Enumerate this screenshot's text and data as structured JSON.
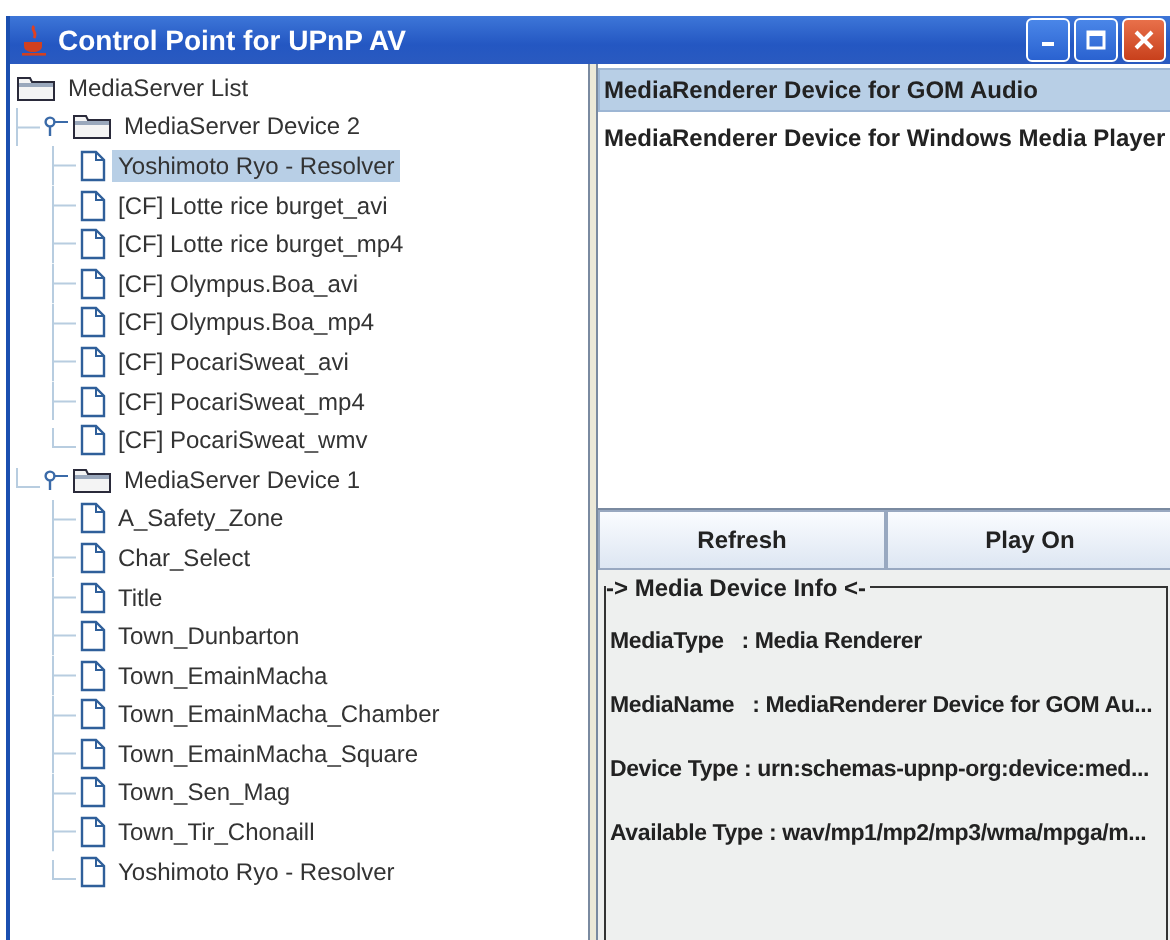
{
  "window": {
    "title": "Control Point for UPnP AV"
  },
  "tree": {
    "label": "MediaServer List",
    "kind": "folder",
    "selected": false,
    "children": [
      {
        "label": "MediaServer Device 2",
        "kind": "folder",
        "expanded": true,
        "selected": false,
        "children": [
          {
            "label": "Yoshimoto Ryo - Resolver",
            "kind": "file",
            "selected": true
          },
          {
            "label": "[CF] Lotte rice burget_avi",
            "kind": "file",
            "selected": false
          },
          {
            "label": "[CF] Lotte rice burget_mp4",
            "kind": "file",
            "selected": false
          },
          {
            "label": "[CF] Olympus.Boa_avi",
            "kind": "file",
            "selected": false
          },
          {
            "label": "[CF] Olympus.Boa_mp4",
            "kind": "file",
            "selected": false
          },
          {
            "label": "[CF] PocariSweat_avi",
            "kind": "file",
            "selected": false
          },
          {
            "label": "[CF] PocariSweat_mp4",
            "kind": "file",
            "selected": false
          },
          {
            "label": "[CF] PocariSweat_wmv",
            "kind": "file",
            "selected": false
          }
        ]
      },
      {
        "label": "MediaServer Device 1",
        "kind": "folder",
        "expanded": true,
        "selected": false,
        "children": [
          {
            "label": "A_Safety_Zone",
            "kind": "file",
            "selected": false
          },
          {
            "label": "Char_Select",
            "kind": "file",
            "selected": false
          },
          {
            "label": "Title",
            "kind": "file",
            "selected": false
          },
          {
            "label": "Town_Dunbarton",
            "kind": "file",
            "selected": false
          },
          {
            "label": "Town_EmainMacha",
            "kind": "file",
            "selected": false
          },
          {
            "label": "Town_EmainMacha_Chamber",
            "kind": "file",
            "selected": false
          },
          {
            "label": "Town_EmainMacha_Square",
            "kind": "file",
            "selected": false
          },
          {
            "label": "Town_Sen_Mag",
            "kind": "file",
            "selected": false
          },
          {
            "label": "Town_Tir_Chonaill",
            "kind": "file",
            "selected": false
          },
          {
            "label": "Yoshimoto Ryo - Resolver",
            "kind": "file",
            "selected": false
          }
        ]
      }
    ]
  },
  "renderers": [
    {
      "label": "MediaRenderer Device for GOM Audio",
      "selected": true
    },
    {
      "label": "MediaRenderer Device for Windows Media Player",
      "selected": false
    }
  ],
  "buttons": [
    "Refresh",
    "Play On"
  ],
  "info": {
    "title": "-> Media Device Info <-",
    "lines": [
      "MediaType   : Media Renderer",
      "MediaName   : MediaRenderer Device for GOM Au...",
      "Device Type : urn:schemas-upnp-org:device:med...",
      "Available Type : wav/mp1/mp2/mp3/wma/mpga/m..."
    ]
  }
}
